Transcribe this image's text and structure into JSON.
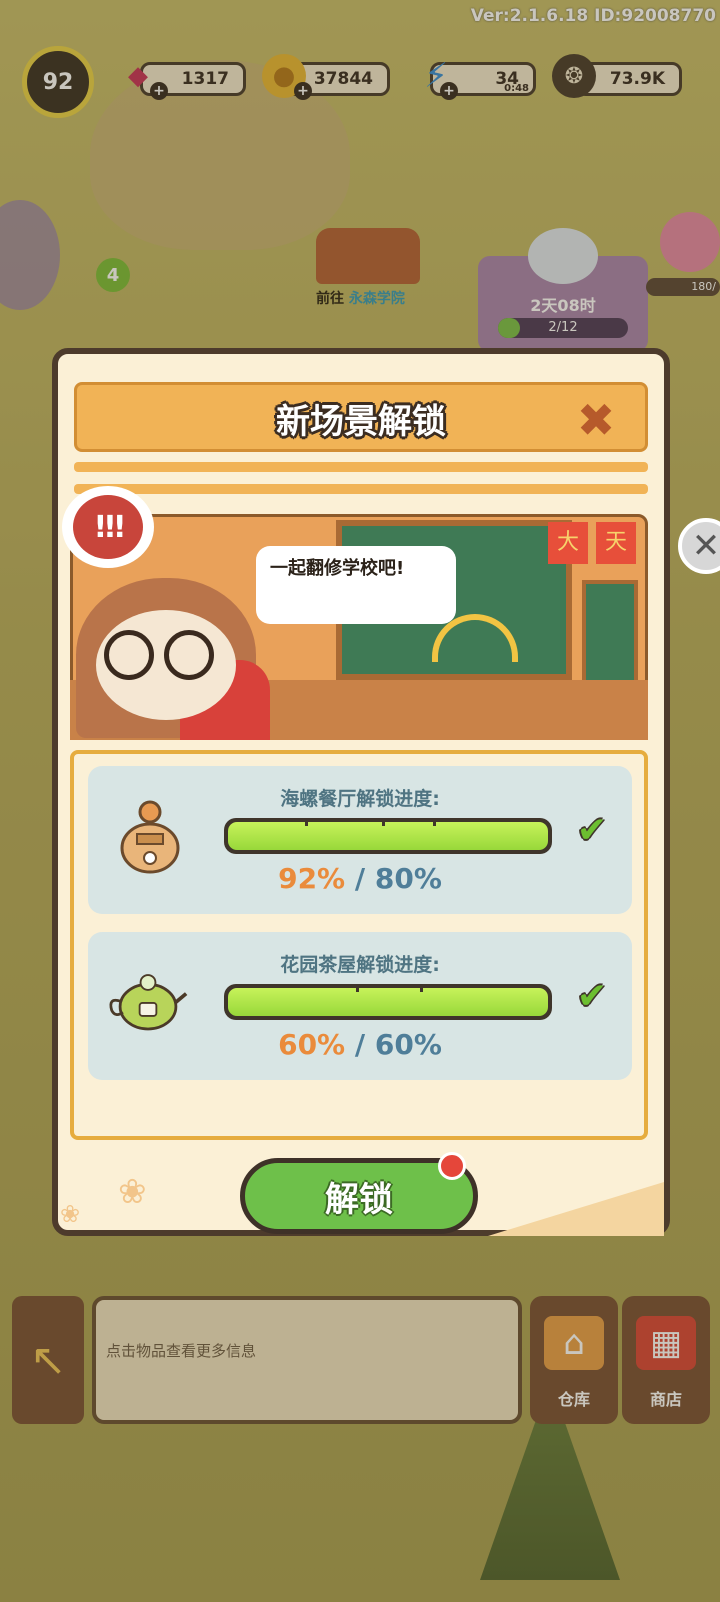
{
  "status_bar": {
    "version": "Ver:2.1.6.18 ID:92008770",
    "level": "92",
    "gems": "1317",
    "coins": "37844",
    "energy": "34",
    "energy_timer": "0:48",
    "seeds": "73.9K"
  },
  "side": {
    "left_counter": "4",
    "goto_prefix": "前往",
    "goto_target": "永森学院",
    "event_time": "2天08时",
    "event_progress": "2/12",
    "event_progress_fraction": 0.17,
    "pig_bar": "180/"
  },
  "modal": {
    "title": "新场景解锁",
    "speech": "一起翻修学校吧!",
    "alert": "!!!",
    "items": [
      {
        "title": "海螺餐厅解锁进度:",
        "current": "92%",
        "separator": " / ",
        "required": "80%",
        "fill_fraction": 1.0
      },
      {
        "title": "花园茶屋解锁进度:",
        "current": "60%",
        "separator": " / ",
        "required": "60%",
        "fill_fraction": 1.0
      }
    ],
    "unlock_label": "解锁",
    "illustration_posters": [
      "大",
      "天"
    ]
  },
  "bottom": {
    "info_text": "点击物品查看更多信息",
    "warehouse_label": "仓库",
    "shop_label": "商店"
  },
  "colors": {
    "accent_orange": "#f1b356",
    "progress_green": "#98d83a",
    "current_pct": "#ea8b3b",
    "required_pct": "#4f7e99"
  }
}
